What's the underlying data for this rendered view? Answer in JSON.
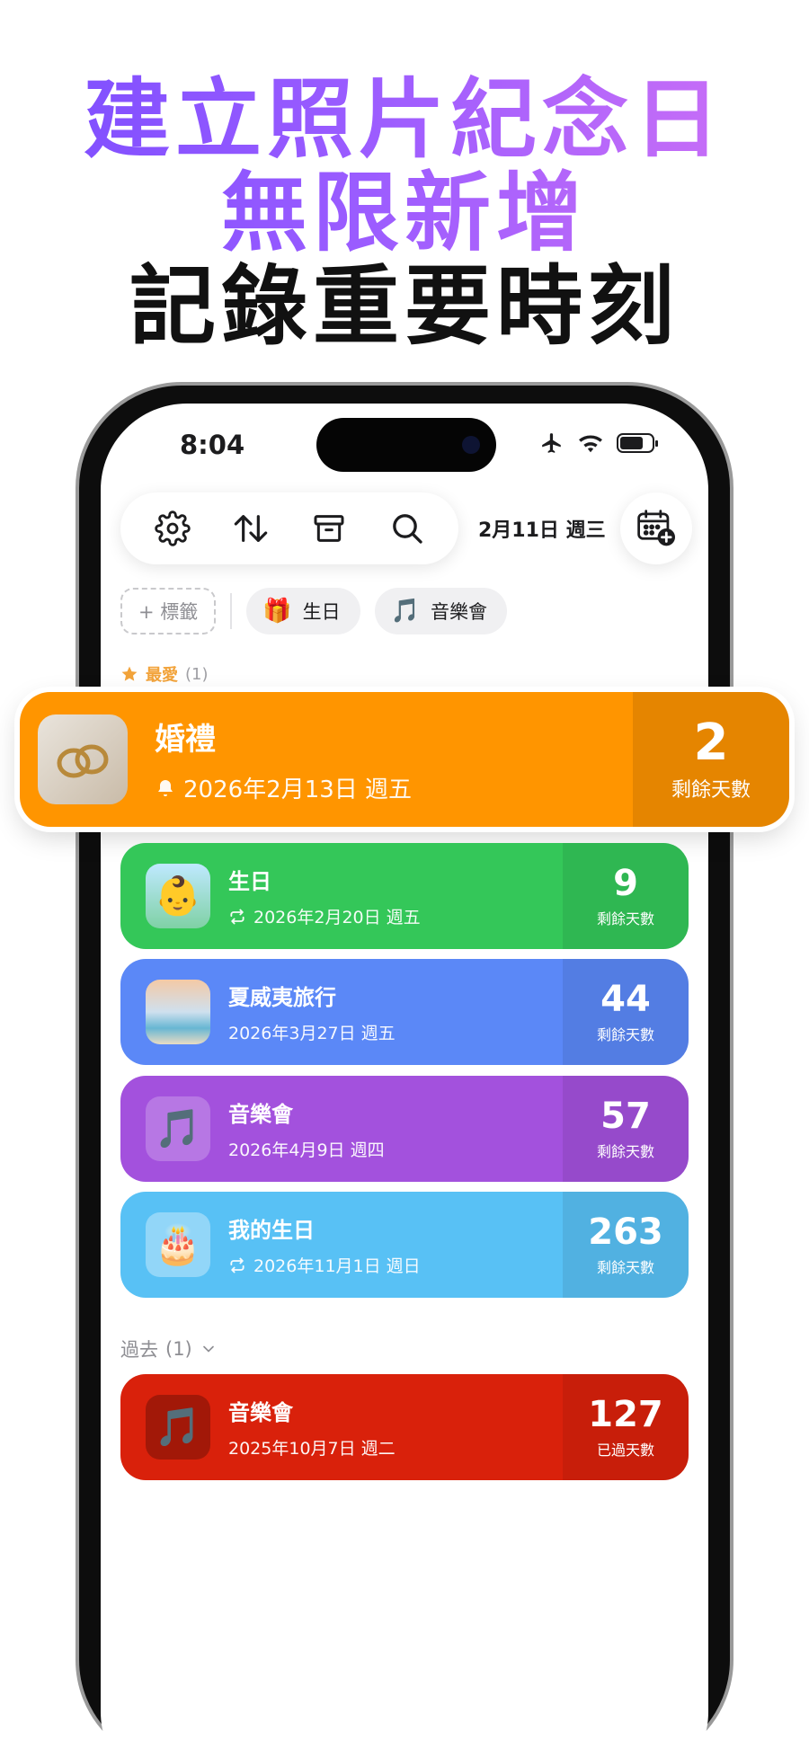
{
  "headline": {
    "line1": "建立照片紀念日",
    "line2": "無限新增",
    "line3": "記錄重要時刻"
  },
  "status_bar": {
    "time": "8:04"
  },
  "toolbar": {
    "date": "2月11日 週三",
    "icons": [
      "gear-icon",
      "sort-icon",
      "archive-icon",
      "search-icon",
      "calendar-add-icon"
    ]
  },
  "tags": {
    "add_label": "+ 標籤",
    "items": [
      {
        "emoji": "🎁",
        "label": "生日"
      },
      {
        "emoji": "🎵",
        "label": "音樂會"
      }
    ]
  },
  "favorites": {
    "label": "最愛",
    "count": "(1)"
  },
  "featured": {
    "title": "婚禮",
    "date": "2026年2月13日 週五",
    "number": "2",
    "number_label": "剩餘天數",
    "color": "#ff9500"
  },
  "events": [
    {
      "title": "生日",
      "date": "2026年2月20日 週五",
      "repeat": true,
      "number": "9",
      "number_label": "剩餘天數",
      "color": "#34c759"
    },
    {
      "title": "夏威夷旅行",
      "date": "2026年3月27日 週五",
      "repeat": false,
      "number": "44",
      "number_label": "剩餘天數",
      "color": "#5b88f7"
    },
    {
      "title": "音樂會",
      "date": "2026年4月9日 週四",
      "repeat": false,
      "number": "57",
      "number_label": "剩餘天數",
      "color": "#a351dd"
    },
    {
      "title": "我的生日",
      "date": "2026年11月1日 週日",
      "repeat": true,
      "number": "263",
      "number_label": "剩餘天數",
      "color": "#58c1f5"
    }
  ],
  "past": {
    "label": "過去",
    "count": "(1)",
    "items": [
      {
        "title": "音樂會",
        "date": "2025年10月7日 週二",
        "number": "127",
        "number_label": "已過天數",
        "color": "#d9210b"
      }
    ]
  }
}
